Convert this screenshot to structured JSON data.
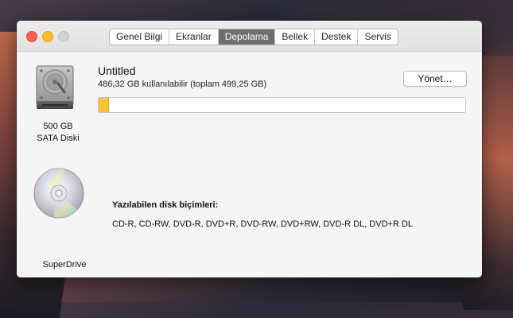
{
  "tabs": [
    {
      "label": "Genel Bilgi",
      "active": false
    },
    {
      "label": "Ekranlar",
      "active": false
    },
    {
      "label": "Depolama",
      "active": true
    },
    {
      "label": "Bellek",
      "active": false
    },
    {
      "label": "Destek",
      "active": false
    },
    {
      "label": "Servis",
      "active": false
    }
  ],
  "disk": {
    "caption_line1": "500 GB",
    "caption_line2": "SATA Diski",
    "icon": "hard-drive-icon"
  },
  "volume": {
    "name": "Untitled",
    "detail": "486,32 GB kullanılabilir (toplam 499,25 GB)",
    "manage_label": "Yönet…",
    "used_fraction": 0.026,
    "bar_color": "#f7c435"
  },
  "optical": {
    "caption": "SuperDrive",
    "icon": "optical-disc-icon",
    "formats_title": "Yazılabilen disk biçimleri:",
    "formats_list": "CD-R, CD-RW, DVD-R, DVD+R, DVD-RW, DVD+RW, DVD-R DL, DVD+R DL"
  }
}
